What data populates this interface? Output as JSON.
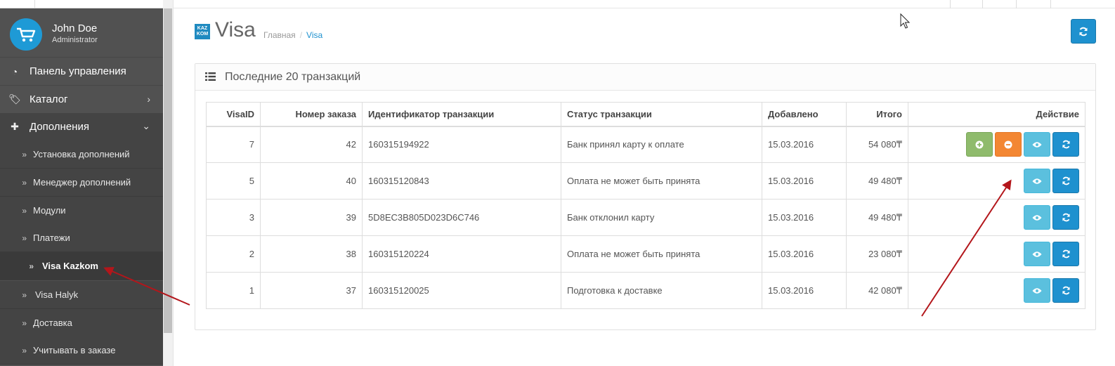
{
  "user": {
    "name": "John Doe",
    "role": "Administrator"
  },
  "sidebar": {
    "items": [
      {
        "label": "Панель управления",
        "icon": "dashboard-icon"
      },
      {
        "label": "Каталог",
        "icon": "tags-icon"
      },
      {
        "label": "Дополнения",
        "icon": "puzzle-icon"
      }
    ],
    "subitems": [
      {
        "label": "Установка дополнений"
      },
      {
        "label": "Менеджер дополнений"
      },
      {
        "label": "Модули"
      },
      {
        "label": "Платежи"
      },
      {
        "label": "Visa Kazkom"
      },
      {
        "label": "Visa Halyk"
      },
      {
        "label": "Доставка"
      },
      {
        "label": "Учитывать в заказе"
      }
    ]
  },
  "page": {
    "logo_text": "KAZ KOM",
    "title": "Visa",
    "breadcrumb": {
      "home": "Главная",
      "separator": "/",
      "current": "Visa"
    }
  },
  "panel": {
    "title": "Последние 20 транзакций",
    "columns": [
      "VisaID",
      "Номер заказа",
      "Идентификатор транзакции",
      "Статус транзакции",
      "Добавлено",
      "Итого",
      "Действие"
    ],
    "rows": [
      {
        "id": "7",
        "order": "42",
        "txn": "160315194922",
        "status": "Банк принял карту к оплате",
        "date": "15.03.2016",
        "total": "54 080₸"
      },
      {
        "id": "5",
        "order": "40",
        "txn": "160315120843",
        "status": "Оплата не может быть принята",
        "date": "15.03.2016",
        "total": "49 480₸"
      },
      {
        "id": "3",
        "order": "39",
        "txn": "5D8EC3B805D023D6C746",
        "status": "Банк отклонил карту",
        "date": "15.03.2016",
        "total": "49 480₸"
      },
      {
        "id": "2",
        "order": "38",
        "txn": "160315120224",
        "status": "Оплата не может быть принята",
        "date": "15.03.2016",
        "total": "23 080₸"
      },
      {
        "id": "1",
        "order": "37",
        "txn": "160315120025",
        "status": "Подготовка к доставке",
        "date": "15.03.2016",
        "total": "42 080₸"
      }
    ]
  },
  "colors": {
    "sidebar_bg": "#515151",
    "submenu_bg": "#444444",
    "accent_blue": "#1e91cf",
    "info_cyan": "#5bc0de",
    "success_green": "#8fbb6c",
    "warning_orange": "#f38733",
    "annotation_arrow": "#b3161b"
  }
}
